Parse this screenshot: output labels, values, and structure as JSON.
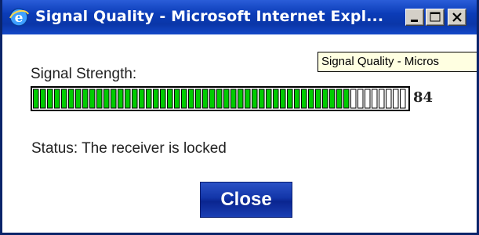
{
  "window": {
    "title": "Signal Quality - Microsoft Internet Expl...",
    "icon": "internet-explorer-icon"
  },
  "controls": {
    "minimize_icon": "minimize-icon",
    "maximize_icon": "maximize-icon",
    "close_icon": "close-icon"
  },
  "tooltip": {
    "text": "Signal Quality - Micros"
  },
  "signal": {
    "label": "Signal Strength:",
    "value": "84",
    "level_percent": 84,
    "fill_color": "#00cc00"
  },
  "status": {
    "text": "Status: The receiver is locked"
  },
  "actions": {
    "close_label": "Close"
  }
}
